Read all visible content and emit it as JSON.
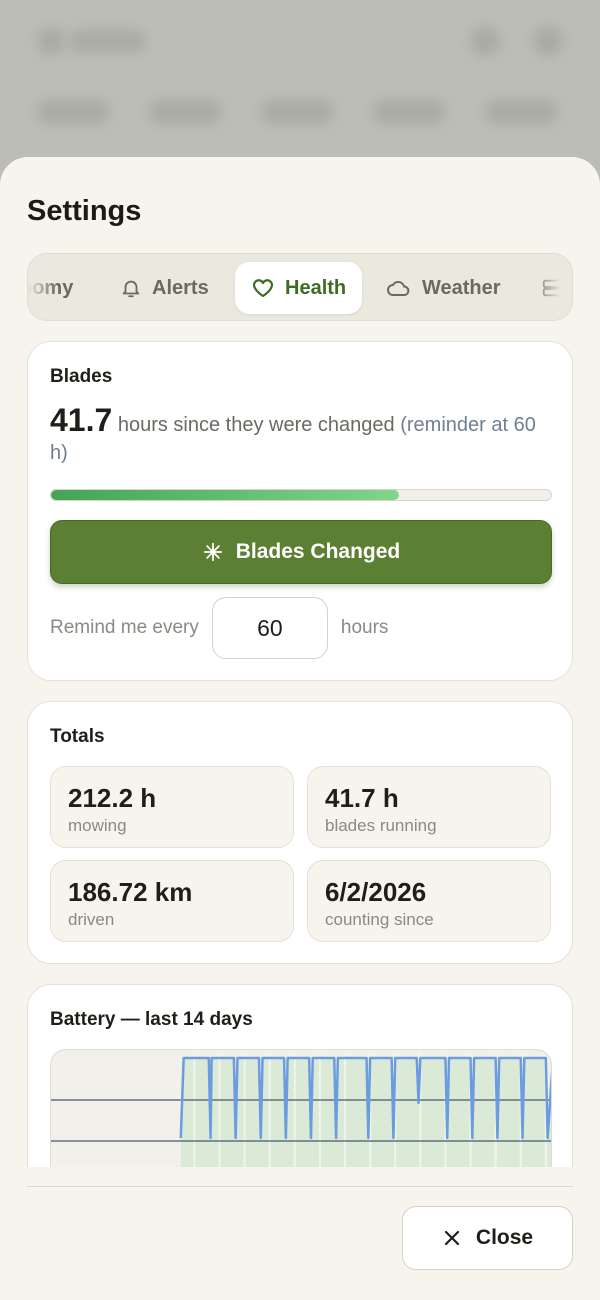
{
  "sheet": {
    "title": "Settings"
  },
  "tabs": [
    {
      "label": "nomy",
      "icon": "leaf-icon",
      "active": false
    },
    {
      "label": "Alerts",
      "icon": "bell-icon",
      "active": false
    },
    {
      "label": "Health",
      "icon": "heart-icon",
      "active": true
    },
    {
      "label": "Weather",
      "icon": "cloud-icon",
      "active": false
    },
    {
      "label": "",
      "icon": "server-icon",
      "active": false
    }
  ],
  "blades": {
    "title": "Blades",
    "hours_value": "41.7",
    "hours_text": " hours since they were changed ",
    "reminder_note": "(reminder at 60 h)",
    "progress_fraction": 0.695,
    "progress_colors": [
      "#46a355",
      "#7fd68b"
    ],
    "changed_button_label": "Blades Changed",
    "changed_button_icon": "sparkle-icon",
    "remind_prefix": "Remind me every",
    "remind_value": "60",
    "remind_suffix": "hours"
  },
  "totals": {
    "title": "Totals",
    "tiles": [
      {
        "value": "212.2 h",
        "label": "mowing"
      },
      {
        "value": "41.7 h",
        "label": "blades running"
      },
      {
        "value": "186.72 km",
        "label": "driven"
      },
      {
        "value": "6/2/2026",
        "label": "counting since"
      }
    ]
  },
  "battery": {
    "title": "Battery — last 14 days",
    "line_color": "#6b9be0",
    "fill_color": "#dbead6"
  },
  "chart_data": {
    "type": "line",
    "title": "Battery — last 14 days",
    "x_unit": "day",
    "xlim": [
      0,
      14
    ],
    "series": [
      {
        "x": [
          0,
          3.6,
          3.62,
          3.7,
          3.75,
          4.4,
          4.45,
          4.48,
          5.1,
          5.15,
          5.2,
          5.8,
          5.85,
          5.9,
          6.5,
          6.55,
          6.6,
          7.2,
          7.25,
          7.3,
          7.9,
          7.95,
          8.0,
          8.8,
          8.85,
          8.9,
          9.5,
          9.55,
          9.6,
          10.2,
          10.25,
          10.3,
          11.0,
          11.05,
          11.1,
          11.7,
          11.75,
          11.8,
          12.4,
          12.45,
          12.5,
          13.1,
          13.15,
          13.2,
          13.8,
          13.85,
          14.0
        ],
        "y": [
          null,
          null,
          20,
          100,
          100,
          100,
          20,
          100,
          100,
          20,
          100,
          100,
          20,
          100,
          100,
          20,
          100,
          100,
          20,
          100,
          100,
          20,
          100,
          100,
          20,
          100,
          100,
          20,
          100,
          100,
          55,
          100,
          100,
          20,
          100,
          100,
          20,
          100,
          100,
          20,
          100,
          100,
          20,
          100,
          100,
          20,
          100
        ]
      }
    ]
  }
}
